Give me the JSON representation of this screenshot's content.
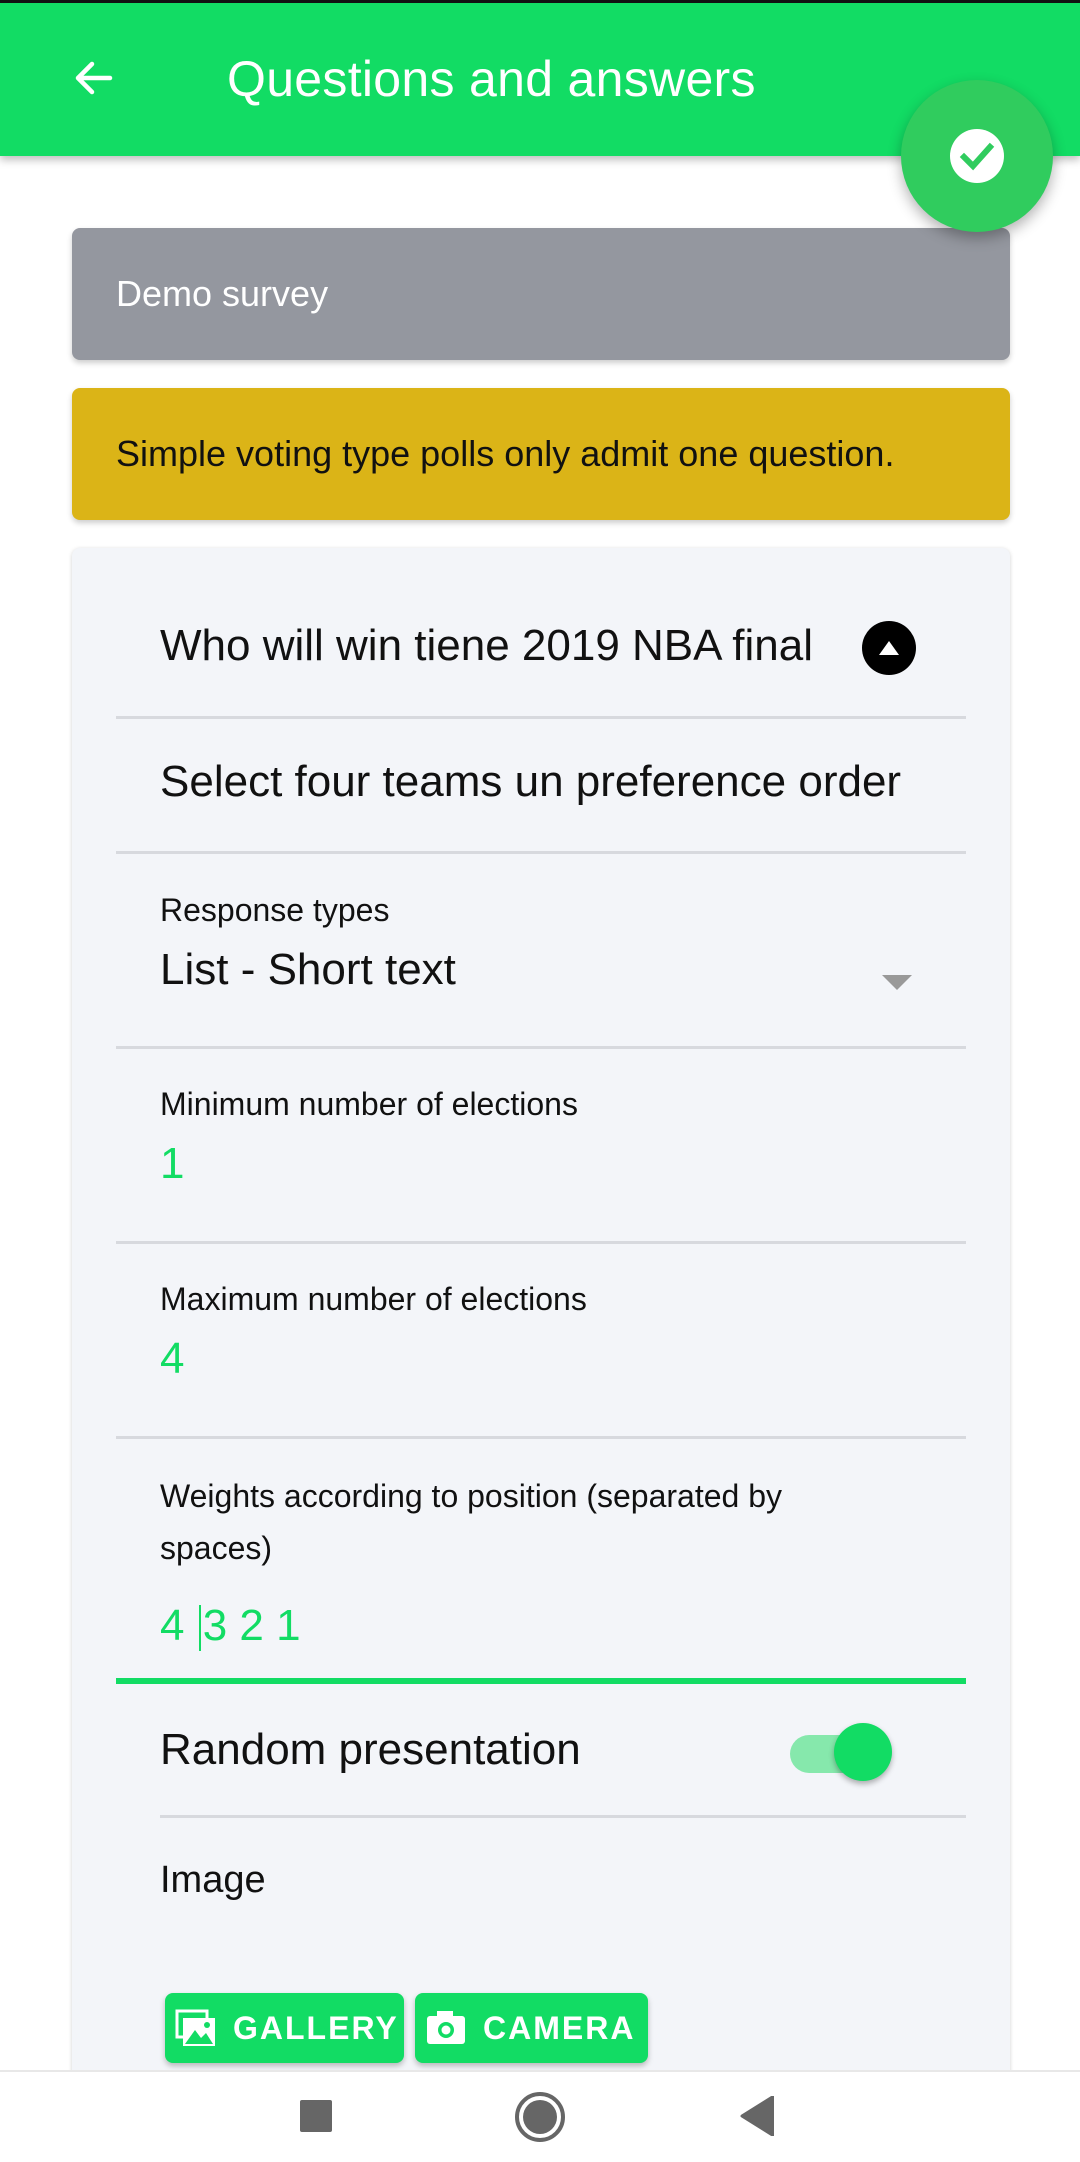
{
  "appbar": {
    "title": "Questions and answers",
    "back_icon": "arrow-left-icon",
    "confirm_icon": "check-circle-icon"
  },
  "survey": {
    "name": "Demo survey"
  },
  "notice": {
    "text": "Simple voting type polls only admit one question."
  },
  "question": {
    "title": "Who will win tiene 2019 NBA final",
    "collapse_icon": "chevron-up-circle-icon",
    "description": "Select four teams un preference order",
    "response_type_label": "Response types",
    "response_type_value": "List - Short text",
    "min_label": "Minimum number of elections",
    "min_value": "1",
    "max_label": "Maximum number of elections",
    "max_value": "4",
    "weights_label": "Weights according to position (separated by spaces)",
    "weights_value_before_caret": "4 ",
    "weights_value_after_caret": "3 2 1",
    "random_label": "Random presentation",
    "random_enabled": true,
    "image_label": "Image",
    "gallery_label": "GALLERY",
    "camera_label": "CAMERA"
  },
  "colors": {
    "primary": "#12dc64",
    "fab": "#30cc5e",
    "survey_card": "#94979f",
    "notice_card": "#dbb417",
    "form_bg": "#f3f5f9"
  },
  "navbar": {
    "recent_icon": "square-recents-icon",
    "home_icon": "circle-home-icon",
    "back_icon": "triangle-back-icon"
  }
}
